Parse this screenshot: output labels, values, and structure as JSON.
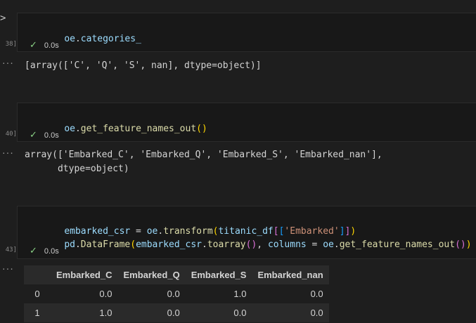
{
  "cells": [
    {
      "exec_count": "38]",
      "code": "oe.categories_",
      "status_time": "0.0s",
      "output": "[array(['C', 'Q', 'S', nan], dtype=object)]"
    },
    {
      "exec_count": "40]",
      "code": "oe.get_feature_names_out()",
      "status_time": "0.0s",
      "output_lines": [
        "array(['Embarked_C', 'Embarked_Q', 'Embarked_S', 'Embarked_nan'],",
        "      dtype=object)"
      ]
    },
    {
      "exec_count": "43]",
      "code_lines": [
        "embarked_csr = oe.transform(titanic_df[['Embarked']])",
        "pd.DataFrame(embarked_csr.toarray(), columns = oe.get_feature_names_out())"
      ],
      "status_time": "0.0s"
    }
  ],
  "code_tokens": {
    "c1": {
      "var": "oe",
      "dot": ".",
      "attr": "categories_"
    },
    "c2": {
      "var": "oe",
      "dot": ".",
      "fn": "get_feature_names_out",
      "p": "()"
    },
    "c3a": {
      "lhs": "embarked_csr",
      "eq": " = ",
      "obj": "oe",
      "dot": ".",
      "fn": "transform",
      "p1o": "(",
      "arg": "titanic_df",
      "p2o": "[",
      "p3o": "[",
      "str": "'Embarked'",
      "p3c": "]",
      "p2c": "]",
      "p1c": ")"
    },
    "c3b": {
      "mod": "pd",
      "dot": ".",
      "fn": "DataFrame",
      "p1o": "(",
      "obj": "embarked_csr",
      "dot2": ".",
      "fn2": "toarray",
      "p2": "()",
      "sep": ", ",
      "kw": "columns",
      "eq": " = ",
      "obj2": "oe",
      "dot3": ".",
      "fn3": "get_feature_names_out",
      "p3": "()",
      "p1c": ")"
    }
  },
  "dataframe": {
    "columns": [
      "",
      "Embarked_C",
      "Embarked_Q",
      "Embarked_S",
      "Embarked_nan"
    ],
    "rows": [
      [
        "0",
        "0.0",
        "0.0",
        "1.0",
        "0.0"
      ],
      [
        "1",
        "1.0",
        "0.0",
        "0.0",
        "0.0"
      ]
    ]
  },
  "ui": {
    "run_chevron": ">",
    "output_dots": "···",
    "check_icon": "✓"
  }
}
